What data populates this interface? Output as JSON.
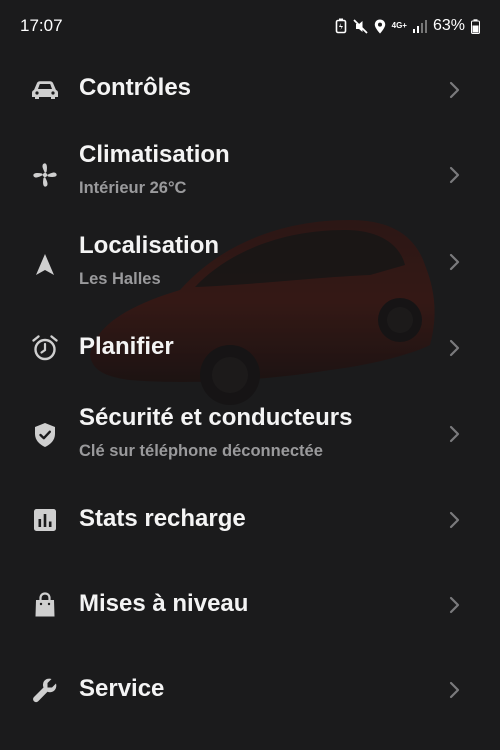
{
  "status_bar": {
    "time": "17:07",
    "network": "4G+",
    "battery_percent": "63%"
  },
  "menu": {
    "items": [
      {
        "id": "controls",
        "title": "Contrôles",
        "subtitle": "",
        "icon": "car-icon"
      },
      {
        "id": "climate",
        "title": "Climatisation",
        "subtitle": "Intérieur 26°C",
        "icon": "fan-icon"
      },
      {
        "id": "location",
        "title": "Localisation",
        "subtitle": "Les Halles",
        "icon": "navigation-arrow-icon"
      },
      {
        "id": "schedule",
        "title": "Planifier",
        "subtitle": "",
        "icon": "alarm-clock-icon"
      },
      {
        "id": "security",
        "title": "Sécurité et conducteurs",
        "subtitle": "Clé sur téléphone déconnectée",
        "icon": "shield-check-icon"
      },
      {
        "id": "charge-stats",
        "title": "Stats recharge",
        "subtitle": "",
        "icon": "bar-chart-icon"
      },
      {
        "id": "upgrades",
        "title": "Mises à niveau",
        "subtitle": "",
        "icon": "shopping-bag-icon"
      },
      {
        "id": "service",
        "title": "Service",
        "subtitle": "",
        "icon": "wrench-icon"
      }
    ]
  },
  "colors": {
    "background": "#1b1b1c",
    "title_text": "#f4f4f4",
    "subtitle_text": "#9a9a9c",
    "icon": "#cfcfcf",
    "chevron": "#7a7a7c",
    "car_accent": "#5a1a14"
  }
}
